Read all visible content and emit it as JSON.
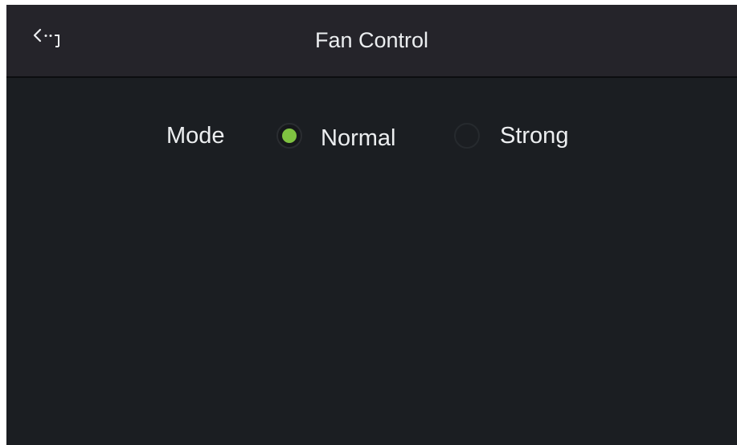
{
  "header": {
    "back_icon": "back-arrow-icon",
    "title": "Fan Control"
  },
  "mode": {
    "label": "Mode",
    "options": [
      {
        "label": "Normal",
        "selected": true
      },
      {
        "label": "Strong",
        "selected": false
      }
    ],
    "selected_color": "#7fc241"
  },
  "colors": {
    "background": "#1b1e22",
    "header_background": "#25242a",
    "text": "#eceef0"
  }
}
